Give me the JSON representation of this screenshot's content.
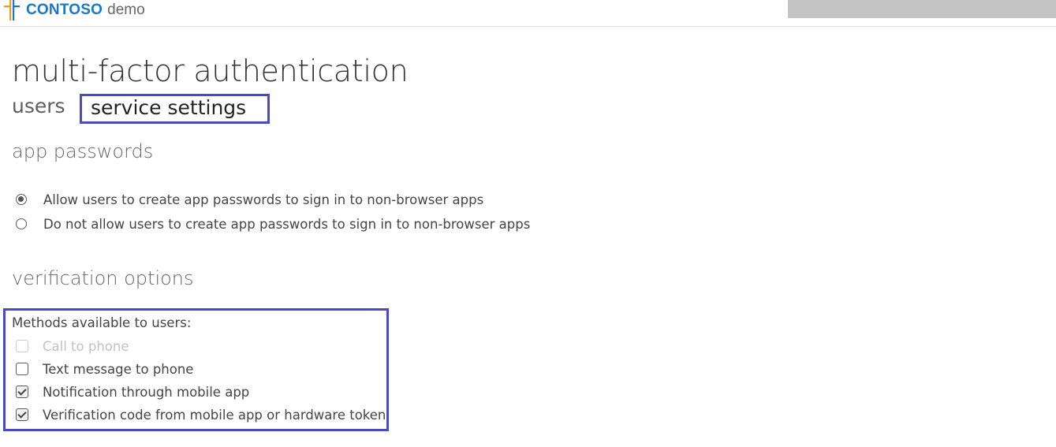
{
  "header": {
    "brand": "CONTOSO",
    "brand_suffix": "demo",
    "accent_color": "#1b78c9",
    "logo_icon": "contoso-cross-icon"
  },
  "page": {
    "title": "multi-factor authentication"
  },
  "tabs": [
    {
      "label": "users",
      "selected": false
    },
    {
      "label": "service settings",
      "selected": true
    }
  ],
  "app_passwords": {
    "heading": "app passwords",
    "options": [
      {
        "label": "Allow users to create app passwords to sign in to non-browser apps",
        "selected": true
      },
      {
        "label": "Do not allow users to create app passwords to sign in to non-browser apps",
        "selected": false
      }
    ]
  },
  "verification_options": {
    "heading": "verification options",
    "methods_label": "Methods available to users:",
    "methods": [
      {
        "label": "Call to phone",
        "checked": false,
        "disabled": true
      },
      {
        "label": "Text message to phone",
        "checked": false,
        "disabled": false
      },
      {
        "label": "Notification through mobile app",
        "checked": true,
        "disabled": false
      },
      {
        "label": "Verification code from mobile app or hardware token",
        "checked": true,
        "disabled": false
      }
    ]
  },
  "highlight_color": "#4a4ac8"
}
